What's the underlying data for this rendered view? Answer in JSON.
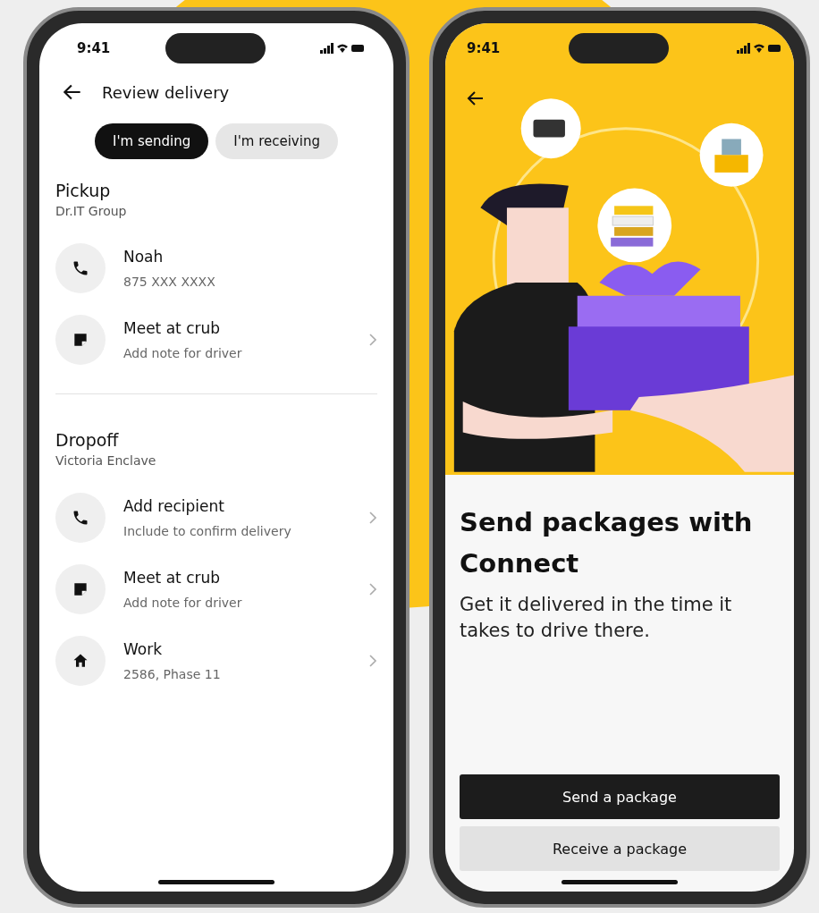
{
  "left_phone": {
    "status_bar": {
      "time": "9:41"
    },
    "header": {
      "title": "Review delivery"
    },
    "tabs": [
      {
        "label": "I'm sending",
        "selected": true
      },
      {
        "label": "I'm receiving",
        "selected": false
      }
    ],
    "sections": [
      {
        "title": "Pickup",
        "subtitle": "Dr.IT Group",
        "rows": [
          {
            "kind": "phone",
            "title": "Noah",
            "detail": "875 XXX XXXX",
            "chevron": false
          },
          {
            "kind": "note",
            "title": "Meet at crub",
            "detail": "Add note for driver",
            "chevron": true
          }
        ]
      },
      {
        "title": "Dropoff",
        "subtitle": "Victoria Enclave",
        "rows": [
          {
            "kind": "phone",
            "title": "Add recipient",
            "detail": "Include to confirm delivery",
            "chevron": true
          },
          {
            "kind": "note",
            "title": "Meet at crub",
            "detail": "Add note for driver",
            "chevron": true
          },
          {
            "kind": "home",
            "title": "Work",
            "detail": "2586, Phase 11",
            "chevron": true
          }
        ]
      }
    ]
  },
  "right_phone": {
    "status_bar": {
      "time": "9:41"
    },
    "heading": "Send packages with Connect",
    "body": "Get it delivered in the time it takes to drive there.",
    "buttons": [
      {
        "label": "Send a package",
        "kind": "primary"
      },
      {
        "label": "Receive a package",
        "kind": "secondary"
      }
    ]
  }
}
